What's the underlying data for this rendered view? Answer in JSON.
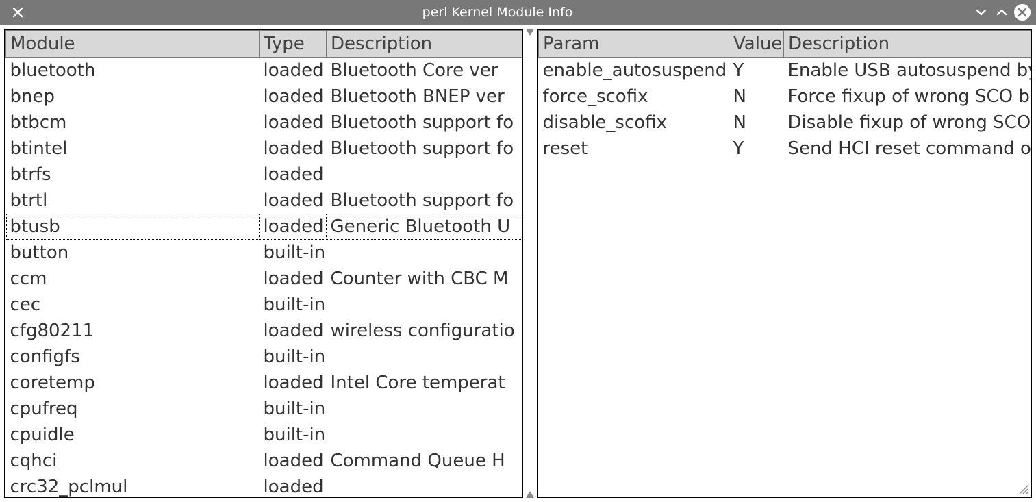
{
  "window": {
    "title": "perl Kernel Module Info"
  },
  "left": {
    "headers": {
      "module": "Module",
      "type": "Type",
      "desc": "Description"
    },
    "selected_index": 6,
    "rows": [
      {
        "module": "bluetooth",
        "type": "loaded",
        "desc": "Bluetooth Core ver"
      },
      {
        "module": "bnep",
        "type": "loaded",
        "desc": "Bluetooth BNEP ver"
      },
      {
        "module": "btbcm",
        "type": "loaded",
        "desc": "Bluetooth support fo"
      },
      {
        "module": "btintel",
        "type": "loaded",
        "desc": "Bluetooth support fo"
      },
      {
        "module": "btrfs",
        "type": "loaded",
        "desc": ""
      },
      {
        "module": "btrtl",
        "type": "loaded",
        "desc": "Bluetooth support fo"
      },
      {
        "module": "btusb",
        "type": "loaded",
        "desc": "Generic Bluetooth U"
      },
      {
        "module": "button",
        "type": "built-in",
        "desc": ""
      },
      {
        "module": "ccm",
        "type": "loaded",
        "desc": "Counter with CBC M"
      },
      {
        "module": "cec",
        "type": "built-in",
        "desc": ""
      },
      {
        "module": "cfg80211",
        "type": "loaded",
        "desc": "wireless configuratio"
      },
      {
        "module": "configfs",
        "type": "built-in",
        "desc": ""
      },
      {
        "module": "coretemp",
        "type": "loaded",
        "desc": "Intel Core temperat"
      },
      {
        "module": "cpufreq",
        "type": "built-in",
        "desc": ""
      },
      {
        "module": "cpuidle",
        "type": "built-in",
        "desc": ""
      },
      {
        "module": "cqhci",
        "type": "loaded",
        "desc": "Command Queue H"
      },
      {
        "module": "crc32_pclmul",
        "type": "loaded",
        "desc": ""
      }
    ]
  },
  "right": {
    "headers": {
      "param": "Param",
      "value": "Value",
      "desc": "Description"
    },
    "rows": [
      {
        "param": "enable_autosuspend",
        "value": "Y",
        "desc": "Enable USB autosuspend by"
      },
      {
        "param": "force_scofix",
        "value": "N",
        "desc": "Force fixup of wrong SCO b"
      },
      {
        "param": "disable_scofix",
        "value": "N",
        "desc": "Disable fixup of wrong SCO"
      },
      {
        "param": "reset",
        "value": "Y",
        "desc": "Send HCI reset command o"
      }
    ]
  }
}
